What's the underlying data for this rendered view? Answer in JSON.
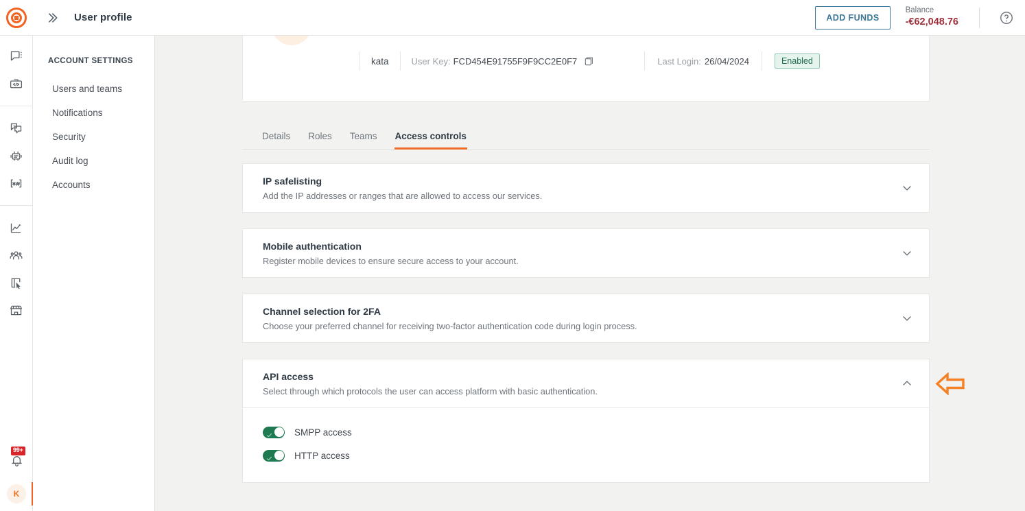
{
  "header": {
    "logo_icon": "concentric-circle-logo",
    "expand_icon": "double-chevron-right-icon",
    "title": "User profile",
    "add_funds_label": "ADD FUNDS",
    "balance_label": "Balance",
    "balance_value": "-€62,048.76",
    "help_icon": "question-circle-icon",
    "accent_color": "#f26322",
    "balance_color": "#9e2f3a",
    "add_funds_color": "#3d7799"
  },
  "rail": {
    "groups": [
      [
        {
          "icon": "chat-bubble-menu-icon",
          "name": "messaging"
        },
        {
          "icon": "code-briefcase-icon",
          "name": "developer-tools"
        }
      ],
      [
        {
          "icon": "copy-pages-icon",
          "name": "campaigns"
        },
        {
          "icon": "robot-icon",
          "name": "chatbots"
        },
        {
          "icon": "number-hash-icon",
          "name": "numbers"
        }
      ],
      [
        {
          "icon": "chart-line-icon",
          "name": "analytics"
        },
        {
          "icon": "people-group-icon",
          "name": "contacts"
        },
        {
          "icon": "panel-cursor-icon",
          "name": "flows"
        },
        {
          "icon": "storefront-icon",
          "name": "marketplace"
        }
      ]
    ],
    "bell": {
      "icon": "bell-icon",
      "badge": "99+",
      "badge_color": "#d9252a"
    },
    "avatar": {
      "initial": "K",
      "bg": "#fdf0e6",
      "fg": "#ec7423"
    }
  },
  "nav": {
    "heading": "ACCOUNT SETTINGS",
    "items": [
      {
        "label": "Users and teams"
      },
      {
        "label": "Notifications"
      },
      {
        "label": "Security"
      },
      {
        "label": "Audit log"
      },
      {
        "label": "Accounts"
      }
    ]
  },
  "profile": {
    "avatar_initial": "",
    "name": "kata",
    "user_key_label": "User Key:",
    "user_key_value": "FCD454E91755F9F9CC2E0F7",
    "copy_icon": "copy-icon",
    "last_login_label": "Last Login:",
    "last_login_value": "26/04/2024",
    "status": "Enabled",
    "status_bg": "#e6f4ee",
    "status_fg": "#1f6b4f"
  },
  "tabs": [
    {
      "label": "Details",
      "active": false
    },
    {
      "label": "Roles",
      "active": false
    },
    {
      "label": "Teams",
      "active": false
    },
    {
      "label": "Access controls",
      "active": true
    }
  ],
  "cards": [
    {
      "title": "IP safelisting",
      "desc": "Add the IP addresses or ranges that are allowed to access our services.",
      "expanded": false,
      "chevron": "chevron-down-icon"
    },
    {
      "title": "Mobile authentication",
      "desc": "Register mobile devices to ensure secure access to your account.",
      "expanded": false,
      "chevron": "chevron-down-icon"
    },
    {
      "title": "Channel selection for 2FA",
      "desc": "Choose your preferred channel for receiving two-factor authentication code during login process.",
      "expanded": false,
      "chevron": "chevron-down-icon"
    },
    {
      "title": "API access",
      "desc": "Select through which protocols the user can access platform with basic authentication.",
      "expanded": true,
      "chevron": "chevron-up-icon"
    }
  ],
  "api_access_toggles": [
    {
      "label": "SMPP access",
      "on": true
    },
    {
      "label": "HTTP access",
      "on": true
    }
  ],
  "annotation": {
    "arrow_icon": "arrow-left-annotation",
    "color": "#f58025"
  }
}
